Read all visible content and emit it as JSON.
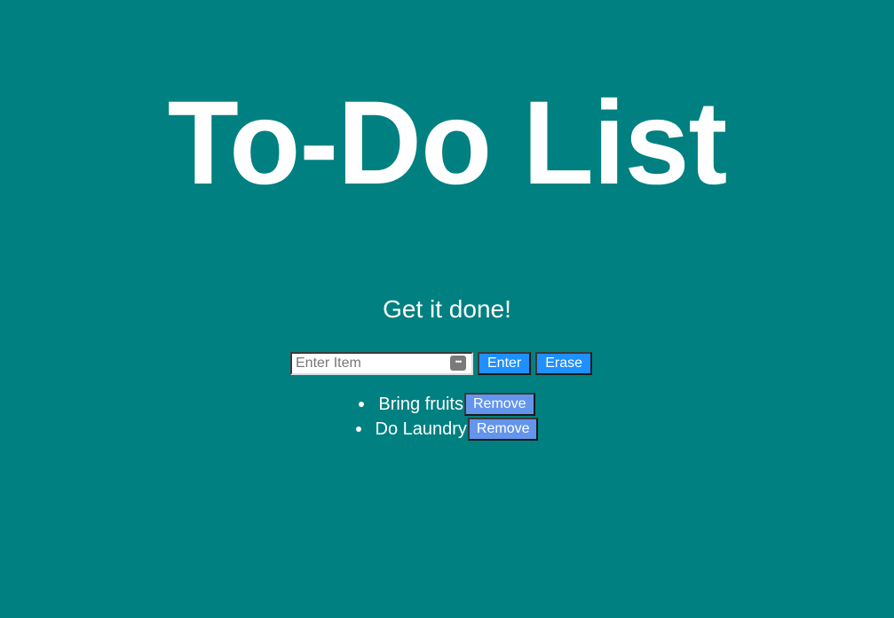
{
  "header": {
    "title": "To-Do List",
    "subtitle": "Get it done!"
  },
  "form": {
    "input_placeholder": "Enter Item",
    "input_value": "",
    "enter_label": "Enter",
    "erase_label": "Erase"
  },
  "items": [
    {
      "text": "Bring fruits",
      "remove_label": "Remove"
    },
    {
      "text": "Do Laundry",
      "remove_label": "Remove"
    }
  ],
  "colors": {
    "background": "#008080",
    "primary_button": "#1e90ff",
    "remove_button": "#6495ed",
    "text": "#ffffff"
  },
  "icons": {
    "input_autofill": "password-manager-icon",
    "bullet": "bullet-dot-icon"
  }
}
